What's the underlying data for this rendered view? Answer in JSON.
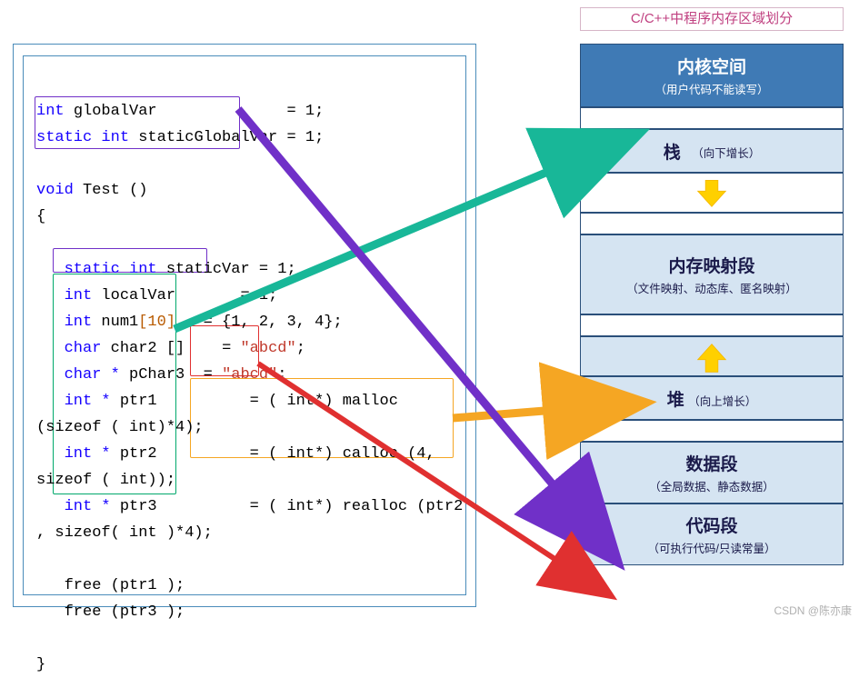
{
  "title": "C/C++中程序内存区域划分",
  "code": {
    "l1_t": "int",
    "l1_v": "globalVar",
    "l1_r": "= 1;",
    "l2_t": "static int",
    "l2_v": "staticGlobalVar",
    "l2_r": "= 1;",
    "l3_t": "void",
    "l3_v": "Test ()",
    "l4": "{",
    "l5_t": "static int",
    "l5_v": "staticVar",
    "l5_r": "= 1;",
    "l6_t": "int",
    "l6_v": "localVar",
    "l6_r": "= 1;",
    "l7_t": "int",
    "l7_v": "num1",
    "l7_i": "[10]",
    "l7_r": "= {1, 2, 3, 4};",
    "l8_t": "char",
    "l8_v": "char2 []",
    "l8_r": "= ",
    "l8_s": "\"abcd\"",
    "l8_e": ";",
    "l9_t": "char *",
    "l9_v": "pChar3",
    "l9_r": "= ",
    "l9_s": "\"abcd\"",
    "l9_e": ";",
    "l10_t": "int *",
    "l10_v": "ptr1",
    "l10_r": "= ( int*) malloc (sizeof ( int)*4);",
    "l11_t": "int *",
    "l11_v": "ptr2",
    "l11_r": "= ( int*) calloc (4, sizeof ( int));",
    "l12_t": "int *",
    "l12_v": "ptr3",
    "l12_r": "= ( int*) realloc (ptr2 , sizeof( int )*4);",
    "l13": "free (ptr1 );",
    "l14": "free (ptr3 );",
    "l15": "}"
  },
  "mem": {
    "kernel_t": "内核空间",
    "kernel_s": "（用户代码不能读写）",
    "stack_t": "栈",
    "stack_s": "（向下增长）",
    "mmap_t": "内存映射段",
    "mmap_s": "（文件映射、动态库、匿名映射）",
    "heap_t": "堆",
    "heap_s": "（向上增长）",
    "data_t": "数据段",
    "data_s": "（全局数据、静态数据）",
    "code_t": "代码段",
    "code_s": "（可执行代码/只读常量）"
  },
  "watermark": "CSDN @陈亦康",
  "icons": {
    "arrow_down": "down-arrow-icon",
    "arrow_up": "up-arrow-icon"
  },
  "chart_data": {
    "type": "diagram",
    "description": "C/C++ program memory layout with code pointers",
    "regions": [
      "内核空间",
      "栈",
      "内存映射段",
      "堆",
      "数据段",
      "代码段"
    ],
    "mappings": [
      {
        "from": "localVar / num1 / char2 / pChar3 / ptr1 / ptr2 / ptr3 (local vars)",
        "to": "栈",
        "color": "teal"
      },
      {
        "from": "malloc / calloc / realloc returned memory",
        "to": "堆",
        "color": "orange"
      },
      {
        "from": "globalVar / staticGlobalVar / staticVar",
        "to": "数据段",
        "color": "purple"
      },
      {
        "from": "\"abcd\" string literal",
        "to": "代码段",
        "color": "red"
      }
    ]
  }
}
